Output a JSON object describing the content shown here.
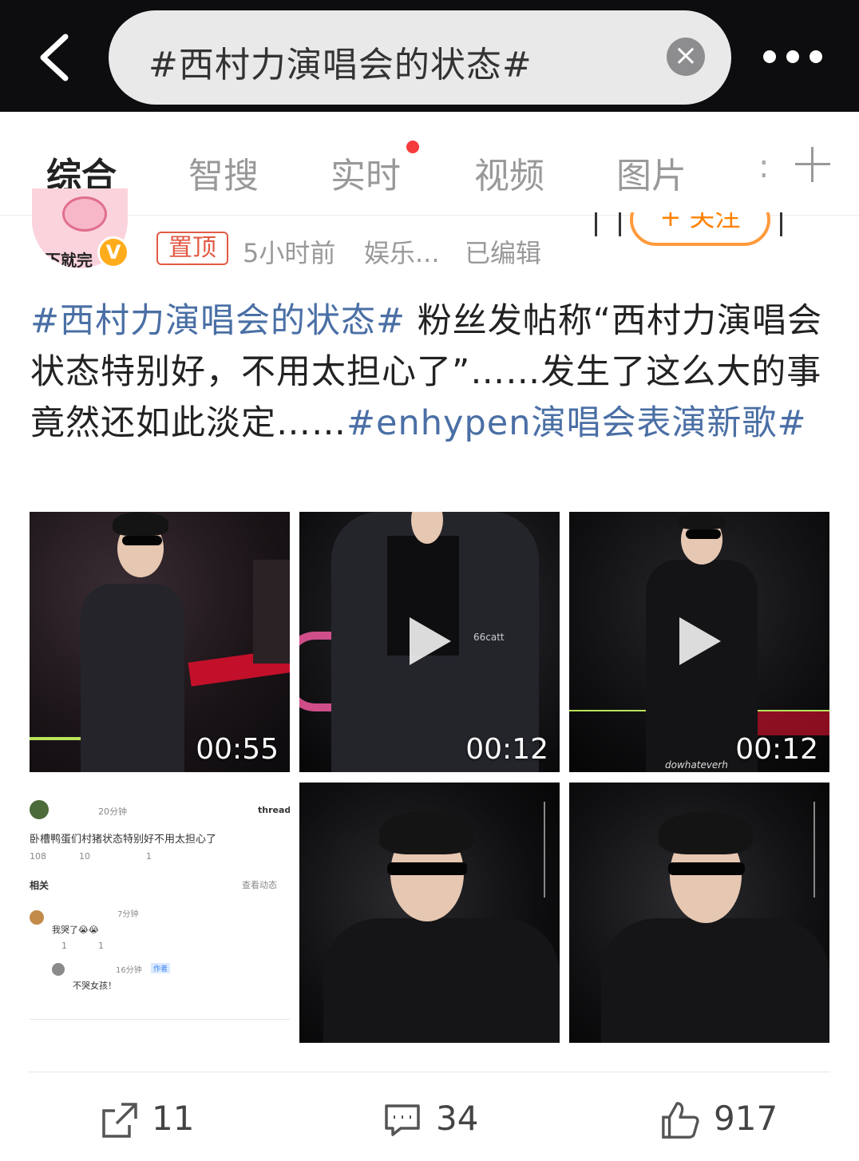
{
  "search": {
    "query": "#西村力演唱会的状态#",
    "clear_glyph": "×"
  },
  "tabs": [
    {
      "label": "综合",
      "active": true
    },
    {
      "label": "智搜"
    },
    {
      "label": "实时",
      "has_red_dot": true
    },
    {
      "label": "视频"
    },
    {
      "label": "图片"
    },
    {
      "label": ":"
    }
  ],
  "post": {
    "avatar_label": "下就完",
    "verified_glyph": "V",
    "pinned_label": "置顶",
    "time": "5小时前",
    "source": "娱乐...",
    "edited": "已编辑",
    "follow_label": "+ 关注",
    "text": {
      "tag1": "#西村力演唱会的状态#",
      "body": "粉丝发帖称“西村力演唱会状态特别好，不用太担心了”……发生了这么大的事竟然还如此淡定……",
      "tag2": "#enhypen演唱会表演新歌#"
    },
    "media": [
      {
        "kind": "video",
        "duration": "00:55"
      },
      {
        "kind": "video",
        "duration": "00:12",
        "overlay_text": "66catt"
      },
      {
        "kind": "video",
        "duration": "00:12",
        "watermark": "dowhateverh"
      },
      {
        "kind": "screenshot"
      },
      {
        "kind": "image"
      },
      {
        "kind": "image"
      }
    ],
    "screenshot": {
      "time": "20分钟",
      "brand": "threads",
      "text": "卧槽鸭蛋们村猪状态特别好不用太担心了",
      "stats": [
        "108",
        "10",
        "1"
      ],
      "related": "相关",
      "view_more": "查看动态",
      "reply_time": "7分钟",
      "reply_text": "我哭了😭😭",
      "reply_stats": [
        "1",
        "1"
      ],
      "sub_time": "16分钟",
      "author_tag": "作者",
      "sub_text": "不哭女孩！"
    },
    "actions": {
      "share": "11",
      "comment": "34",
      "like": "917"
    }
  },
  "colors": {
    "accent": "#ff8200",
    "tag": "#4a6fa5",
    "pin": "#e25a45",
    "dot": "#f63b3b"
  }
}
